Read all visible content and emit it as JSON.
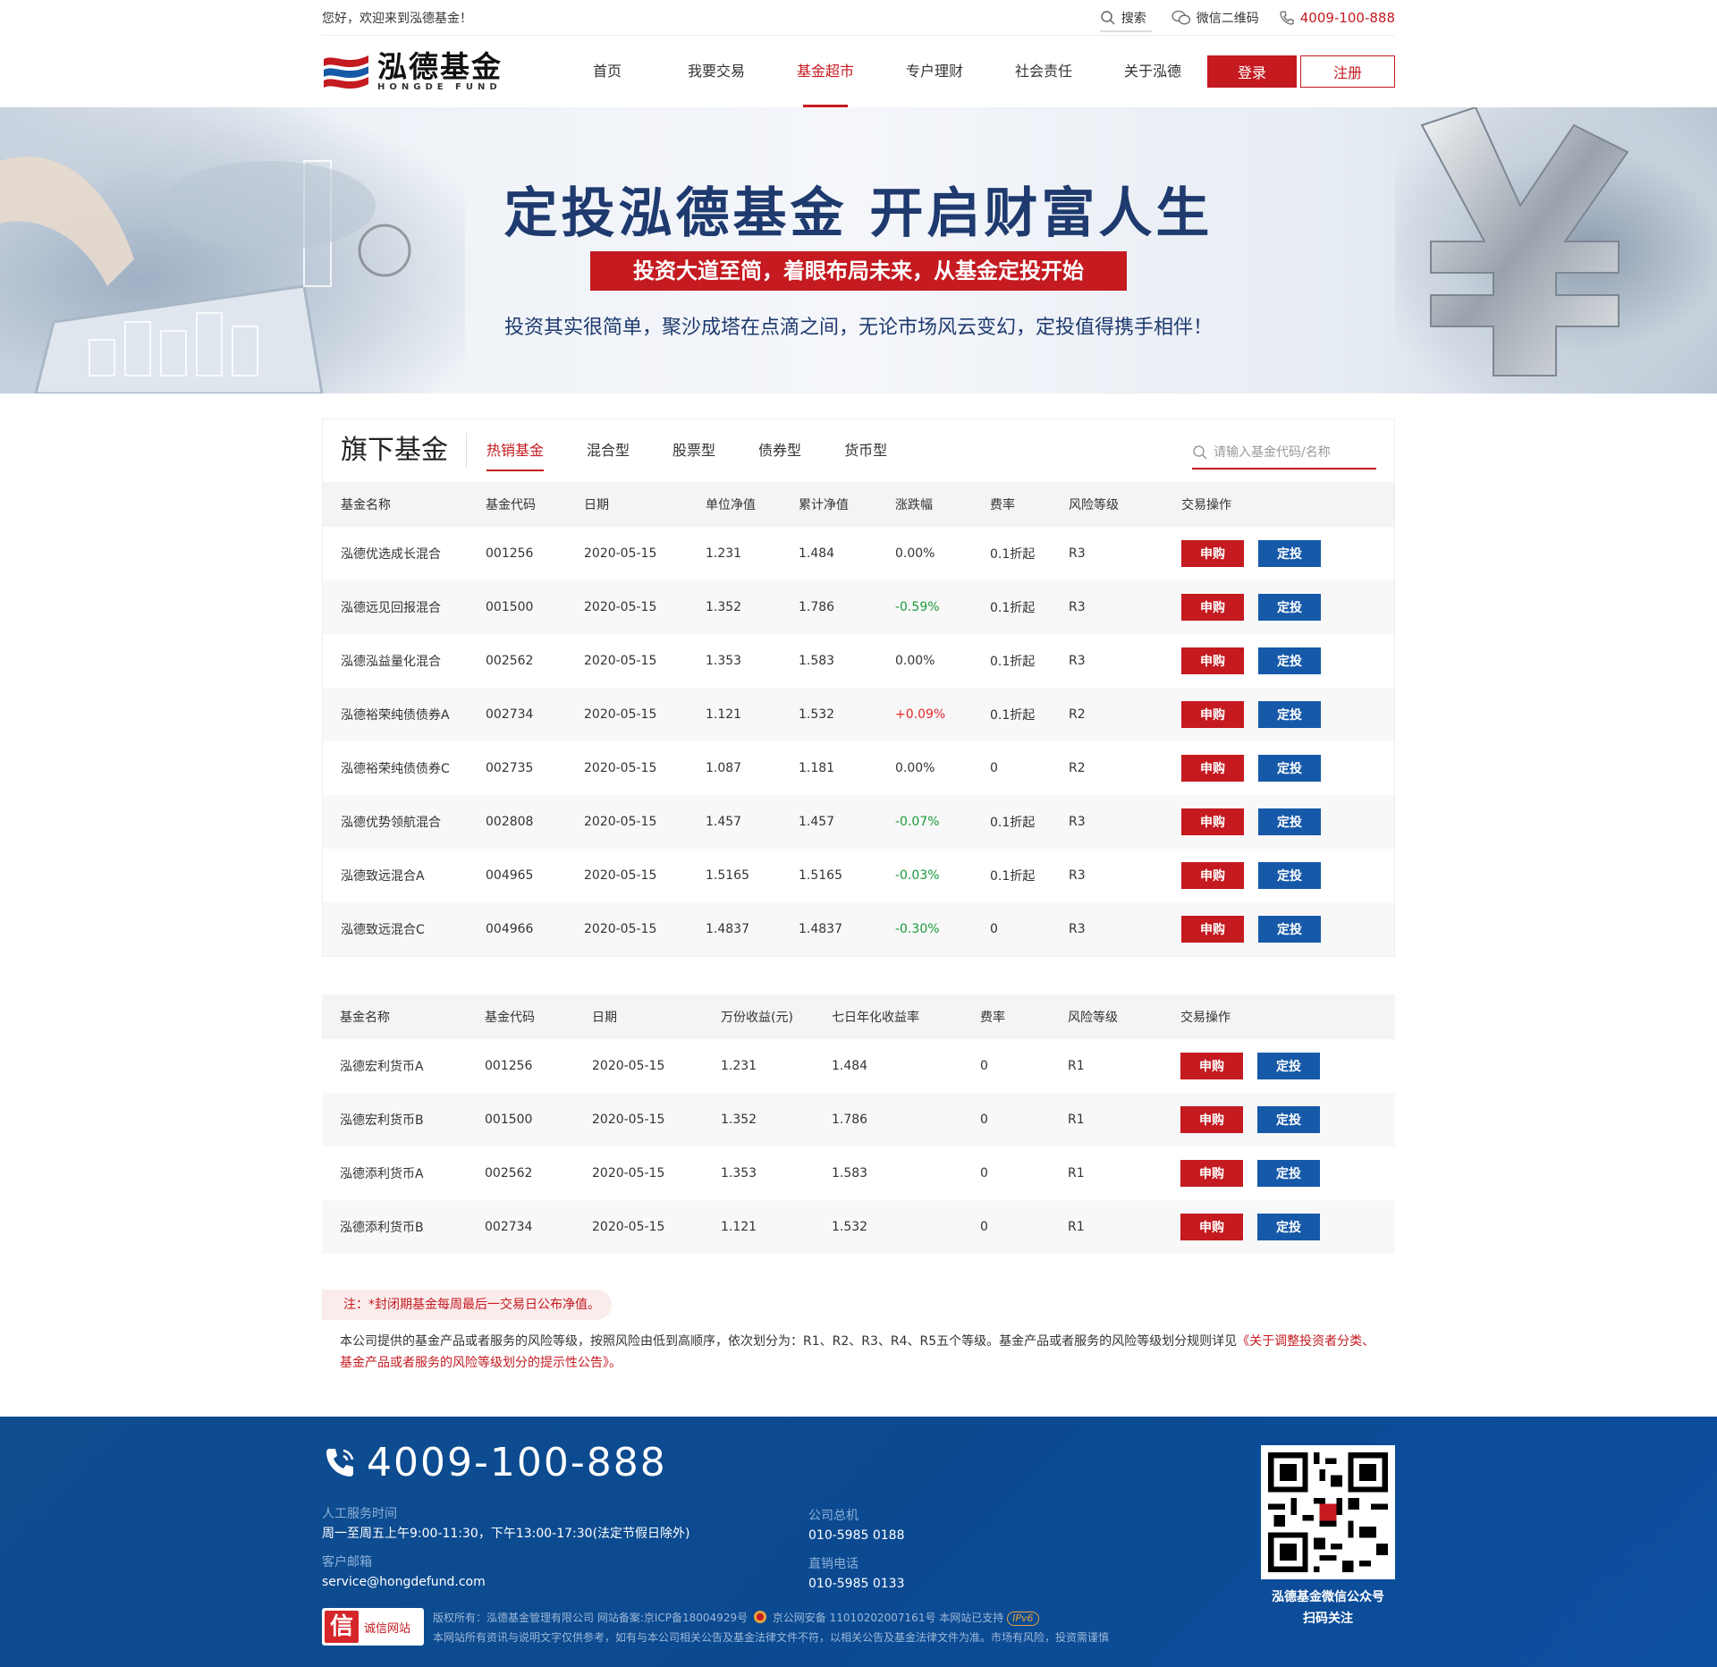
{
  "topbar": {
    "welcome": "您好，欢迎来到泓德基金！",
    "search_label": "搜索",
    "wechat_label": "微信二维码",
    "phone": "4009-100-888"
  },
  "logo": {
    "cn": "泓德基金",
    "en": "HONGDE FUND"
  },
  "nav": {
    "items": [
      {
        "label": "首页"
      },
      {
        "label": "我要交易"
      },
      {
        "label": "基金超市",
        "active": true
      },
      {
        "label": "专户理财"
      },
      {
        "label": "社会责任"
      },
      {
        "label": "关于泓德"
      }
    ],
    "login": "登录",
    "register": "注册"
  },
  "banner": {
    "title": "定投泓德基金  开启财富人生",
    "subtitle": "投资大道至简，着眼布局未来，从基金定投开始",
    "desc": "投资其实很简单，聚沙成塔在点滴之间，无论市场风云变幻，定投值得携手相伴！"
  },
  "funds": {
    "title": "旗下基金",
    "tabs": [
      "热销基金",
      "混合型",
      "股票型",
      "债券型",
      "货币型"
    ],
    "search_placeholder": "请输入基金代码/名称",
    "headers": [
      "基金名称",
      "基金代码",
      "日期",
      "单位净值",
      "累计净值",
      "涨跌幅",
      "费率",
      "风险等级",
      "交易操作"
    ],
    "rows": [
      {
        "name": "泓德优选成长混合",
        "code": "001256",
        "date": "2020-05-15",
        "nav": "1.231",
        "acc": "1.484",
        "chg": "0.00%",
        "dir": "flat",
        "fee": "0.1折起",
        "risk": "R3"
      },
      {
        "name": "泓德远见回报混合",
        "code": "001500",
        "date": "2020-05-15",
        "nav": "1.352",
        "acc": "1.786",
        "chg": "-0.59%",
        "dir": "neg",
        "fee": "0.1折起",
        "risk": "R3"
      },
      {
        "name": "泓德泓益量化混合",
        "code": "002562",
        "date": "2020-05-15",
        "nav": "1.353",
        "acc": "1.583",
        "chg": "0.00%",
        "dir": "flat",
        "fee": "0.1折起",
        "risk": "R3"
      },
      {
        "name": "泓德裕荣纯债债券A",
        "code": "002734",
        "date": "2020-05-15",
        "nav": "1.121",
        "acc": "1.532",
        "chg": "+0.09%",
        "dir": "pos",
        "fee": "0.1折起",
        "risk": "R2"
      },
      {
        "name": "泓德裕荣纯债债券C",
        "code": "002735",
        "date": "2020-05-15",
        "nav": "1.087",
        "acc": "1.181",
        "chg": "0.00%",
        "dir": "flat",
        "fee": "0",
        "risk": "R2"
      },
      {
        "name": "泓德优势领航混合",
        "code": "002808",
        "date": "2020-05-15",
        "nav": "1.457",
        "acc": "1.457",
        "chg": "-0.07%",
        "dir": "neg",
        "fee": "0.1折起",
        "risk": "R3"
      },
      {
        "name": "泓德致远混合A",
        "code": "004965",
        "date": "2020-05-15",
        "nav": "1.5165",
        "acc": "1.5165",
        "chg": "-0.03%",
        "dir": "neg",
        "fee": "0.1折起",
        "risk": "R3"
      },
      {
        "name": "泓德致远混合C",
        "code": "004966",
        "date": "2020-05-15",
        "nav": "1.4837",
        "acc": "1.4837",
        "chg": "-0.30%",
        "dir": "neg",
        "fee": "0",
        "risk": "R3"
      }
    ],
    "buy_label": "申购",
    "aip_label": "定投"
  },
  "money": {
    "headers": [
      "基金名称",
      "基金代码",
      "日期",
      "万份收益(元)",
      "七日年化收益率",
      "费率",
      "风险等级",
      "交易操作"
    ],
    "rows": [
      {
        "name": "泓德宏利货币A",
        "code": "001256",
        "date": "2020-05-15",
        "income": "1.231",
        "yield7": "1.484",
        "fee": "0",
        "risk": "R1"
      },
      {
        "name": "泓德宏利货币B",
        "code": "001500",
        "date": "2020-05-15",
        "income": "1.352",
        "yield7": "1.786",
        "fee": "0",
        "risk": "R1"
      },
      {
        "name": "泓德添利货币A",
        "code": "002562",
        "date": "2020-05-15",
        "income": "1.353",
        "yield7": "1.583",
        "fee": "0",
        "risk": "R1"
      },
      {
        "name": "泓德添利货币B",
        "code": "002734",
        "date": "2020-05-15",
        "income": "1.121",
        "yield7": "1.532",
        "fee": "0",
        "risk": "R1"
      }
    ]
  },
  "notes": {
    "tag": "注：*封闭期基金每周最后一交易日公布净值。",
    "text": "本公司提供的基金产品或者服务的风险等级，按照风险由低到高顺序，依次划分为：R1、R2、R3、R4、R5五个等级。基金产品或者服务的风险等级划分规则详见",
    "link": "《关于调整投资者分类、基金产品或者服务的风险等级划分的提示性公告》",
    "end": "。"
  },
  "footer": {
    "phone": "4009-100-888",
    "service_label": "人工服务时间",
    "service_val": "周一至周五上午9:00-11:30，下午13:00-17:30(法定节假日除外)",
    "email_label": "客户邮箱",
    "email_val": "service@hongdefund.com",
    "hq_label": "公司总机",
    "hq_val": "010-5985 0188",
    "direct_label": "直销电话",
    "direct_val": "010-5985 0133",
    "qr_caption_1": "泓德基金微信公众号",
    "qr_caption_2": "扫码关注",
    "badge_icon": "信",
    "badge_text": "诚信网站",
    "legal_1a": "版权所有：泓德基金管理有限公司    网站备案:京ICP备18004929号",
    "legal_1b": "京公网安备 11010202007161号  本网站已支持",
    "ipv6": "IPv6",
    "legal_2": "本网站所有资讯与说明文字仅供参考，如有与本公司相关公告及基金法律文件不符，以相关公告及基金法律文件为准。市场有风险，投资需谨慎"
  },
  "colors": {
    "brand_red": "#c41a20",
    "brand_blue": "#1659a8",
    "footer_blue": "#0b4a91",
    "up": "#e0262b",
    "down": "#1a9a3a"
  }
}
